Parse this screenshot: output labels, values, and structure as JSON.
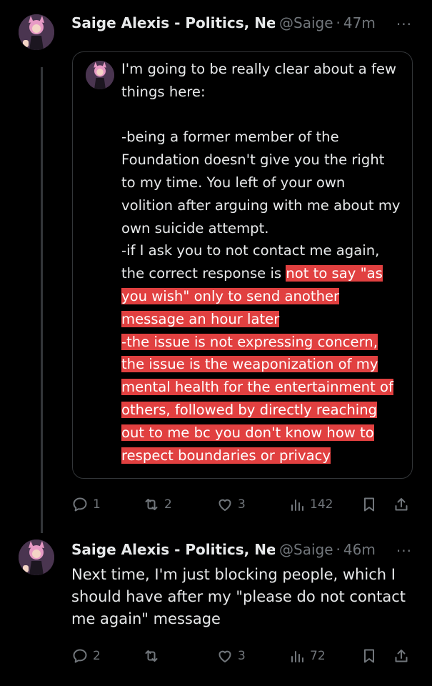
{
  "tweet1": {
    "author_name": "Saige Alexis - Politics, Ne",
    "handle": "@Saige",
    "time": "47m",
    "quote": {
      "line1": "I'm going to be really clear about a few",
      "line2": "things here:",
      "line3": "-being a former member of the",
      "line4": "Foundation doesn't give you the right",
      "line5": "to my time. You left of your own",
      "line6": "volition after arguing with me about my",
      "line7": "own suicide attempt.",
      "line8": "-if I ask you to not contact me again,",
      "line9a": "the correct response is ",
      "line9b": "not to say \"as",
      "line10": "you wish\" only to send another",
      "line11": "message an hour later",
      "line12": "-the issue is not expressing concern,",
      "line13": "the issue is the weaponization of my",
      "line14": "mental health for the entertainment of",
      "line15": "others, followed by directly reaching",
      "line16": "out to me bc you don't know how to",
      "line17": "respect boundaries or privacy"
    },
    "actions": {
      "replies": "1",
      "reposts": "2",
      "likes": "3",
      "views": "142"
    }
  },
  "tweet2": {
    "author_name": "Saige Alexis - Politics, Ne",
    "handle": "@Saige",
    "time": "46m",
    "text": "Next time, I'm just blocking people, which I should have after my \"please do not contact me again\" message",
    "actions": {
      "replies": "2",
      "reposts": "",
      "likes": "3",
      "views": "72"
    }
  },
  "ui": {
    "dot": "·",
    "more": "···"
  },
  "colors": {
    "background": "#000000",
    "text": "#e7e9ea",
    "muted": "#71767b",
    "highlight": "#e14040",
    "border": "#333639"
  },
  "icons": [
    "reply-icon",
    "repost-icon",
    "like-icon",
    "views-icon",
    "bookmark-icon",
    "share-icon",
    "more-icon"
  ]
}
